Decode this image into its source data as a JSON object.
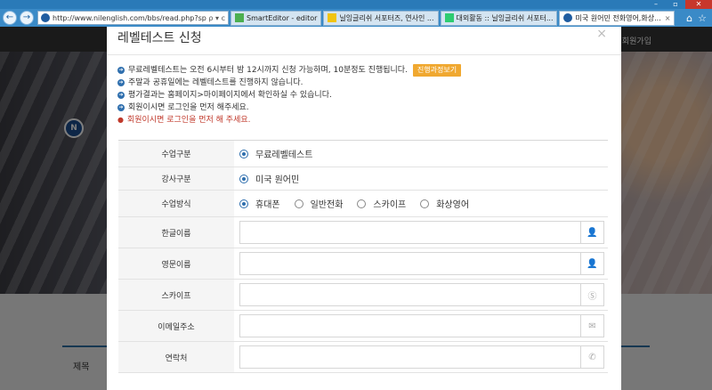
{
  "browser": {
    "address_url": "http://www.nilenglish.com/bbs/read.php?sp=5&table",
    "tabs": [
      {
        "label": "SmartEditor - editor",
        "active": false
      },
      {
        "label": "닐잉글리쉬 서포터즈, 연사인 ...",
        "active": false
      },
      {
        "label": "대외활동 :: 닐잉글리쉬 서포터...",
        "active": false
      },
      {
        "label": "미국 원어민 전화영어,화상...",
        "active": true
      }
    ],
    "tab_close": "×",
    "addr_controls": "ρ ▾ c"
  },
  "page": {
    "join_link": "회원가입",
    "title_label": "제목"
  },
  "modal": {
    "title": "레벨테스트 신청",
    "close_symbol": "×",
    "notices": [
      {
        "text": "무료레벨테스트는 오전 6시부터 밤 12시까지 신청 가능하며, 10분정도 진행됩니다.",
        "button": "진행과정보기"
      },
      {
        "text": "주말과 공휴일에는 레벨테스트를 진행하지 않습니다."
      },
      {
        "text": "평가결과는 홈페이지>마이페이지에서 확인하실 수 있습니다."
      },
      {
        "text": "회원이시면 로그인을 먼저 해주세요."
      }
    ],
    "warning": "회원이시면 로그인을 먼저 해 주세요.",
    "form": {
      "class_type_label": "수업구분",
      "class_type_option": "무료레벨테스트",
      "teacher_label": "강사구분",
      "teacher_option": "미국 원어민",
      "method_label": "수업방식",
      "method_options": [
        "휴대폰",
        "일반전화",
        "스카이프",
        "화상영어"
      ],
      "korean_name_label": "한글이름",
      "english_name_label": "영문이름",
      "skype_label": "스카이프",
      "email_label": "이메일주소",
      "contact_label": "연락처"
    }
  },
  "colors": {
    "accent": "#2f6fae",
    "button": "#f0a830",
    "warning": "#c0392b"
  }
}
